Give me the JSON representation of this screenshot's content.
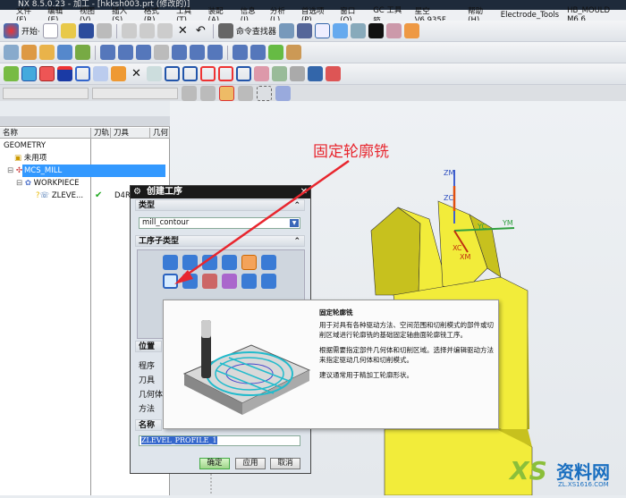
{
  "window": {
    "title": "NX 8.5.0.23 - 加工 - [hkksh003.prt (修改的)]"
  },
  "menu": [
    "文件(F)",
    "编辑(E)",
    "视图(V)",
    "插入(S)",
    "格式(R)",
    "工具(T)",
    "装配(A)",
    "信息(I)",
    "分析(L)",
    "首选项(P)",
    "窗口(O)",
    "GC 工具箱",
    "星空 V6.935F",
    "帮助(H)",
    "Electrode_Tools",
    "HB_MOULD M6.6"
  ],
  "toolbar": {
    "start_label": "开始·",
    "command_finder_label": "命令查找器"
  },
  "combos": {
    "filter": "",
    "selection": ""
  },
  "navigator": {
    "columns": [
      "名称",
      "刀轨",
      "刀具",
      "几何"
    ],
    "rows": [
      {
        "name": "GEOMETRY",
        "toolpath": "",
        "tool": ""
      },
      {
        "name": "未用项",
        "toolpath": "",
        "tool": ""
      },
      {
        "name": "MCS_MILL",
        "toolpath": "",
        "tool": "",
        "selected": true
      },
      {
        "name": "WORKPIECE",
        "toolpath": "",
        "tool": ""
      },
      {
        "name": "ZLEVE...",
        "toolpath": "✔",
        "tool": "D4R"
      }
    ]
  },
  "annotation": {
    "text": "固定轮廓铣",
    "color": "#e8262e"
  },
  "dialog": {
    "title": "创建工序",
    "type_section": "类型",
    "type_value": "mill_contour",
    "subtype_section": "工序子类型",
    "location_section": "位置",
    "location_fields": [
      "程序",
      "刀具",
      "几何体",
      "方法"
    ],
    "name_section": "名称",
    "name_value": "ZLEVEL_PROFILE_1",
    "buttons": {
      "ok": "确定",
      "apply": "应用",
      "cancel": "取消"
    }
  },
  "tooltip": {
    "title": "固定轮廓铣",
    "paragraphs": [
      "用于对具有各种驱动方法、空间范围和切削模式的部件或切削区域进行轮廓铣的基础固定轴曲面轮廓铣工序。",
      "根据需要指定部件几何体和切削区域。选择并编辑驱动方法来指定驱动几何体和切削模式。",
      "建议通常用于精加工轮廓形状。"
    ]
  },
  "csys_labels": {
    "zm": "ZM",
    "zc": "ZC",
    "yc": "YC",
    "ym": "YM",
    "xc": "XC",
    "xm": "XM"
  },
  "watermark": {
    "text": "资料网",
    "url_text": "ZL.XS1616.COM"
  },
  "colors": {
    "accent_selected": "#3399ff",
    "part_yellow": "#f2ec3a",
    "dialog_bg": "#dfe5ec"
  }
}
